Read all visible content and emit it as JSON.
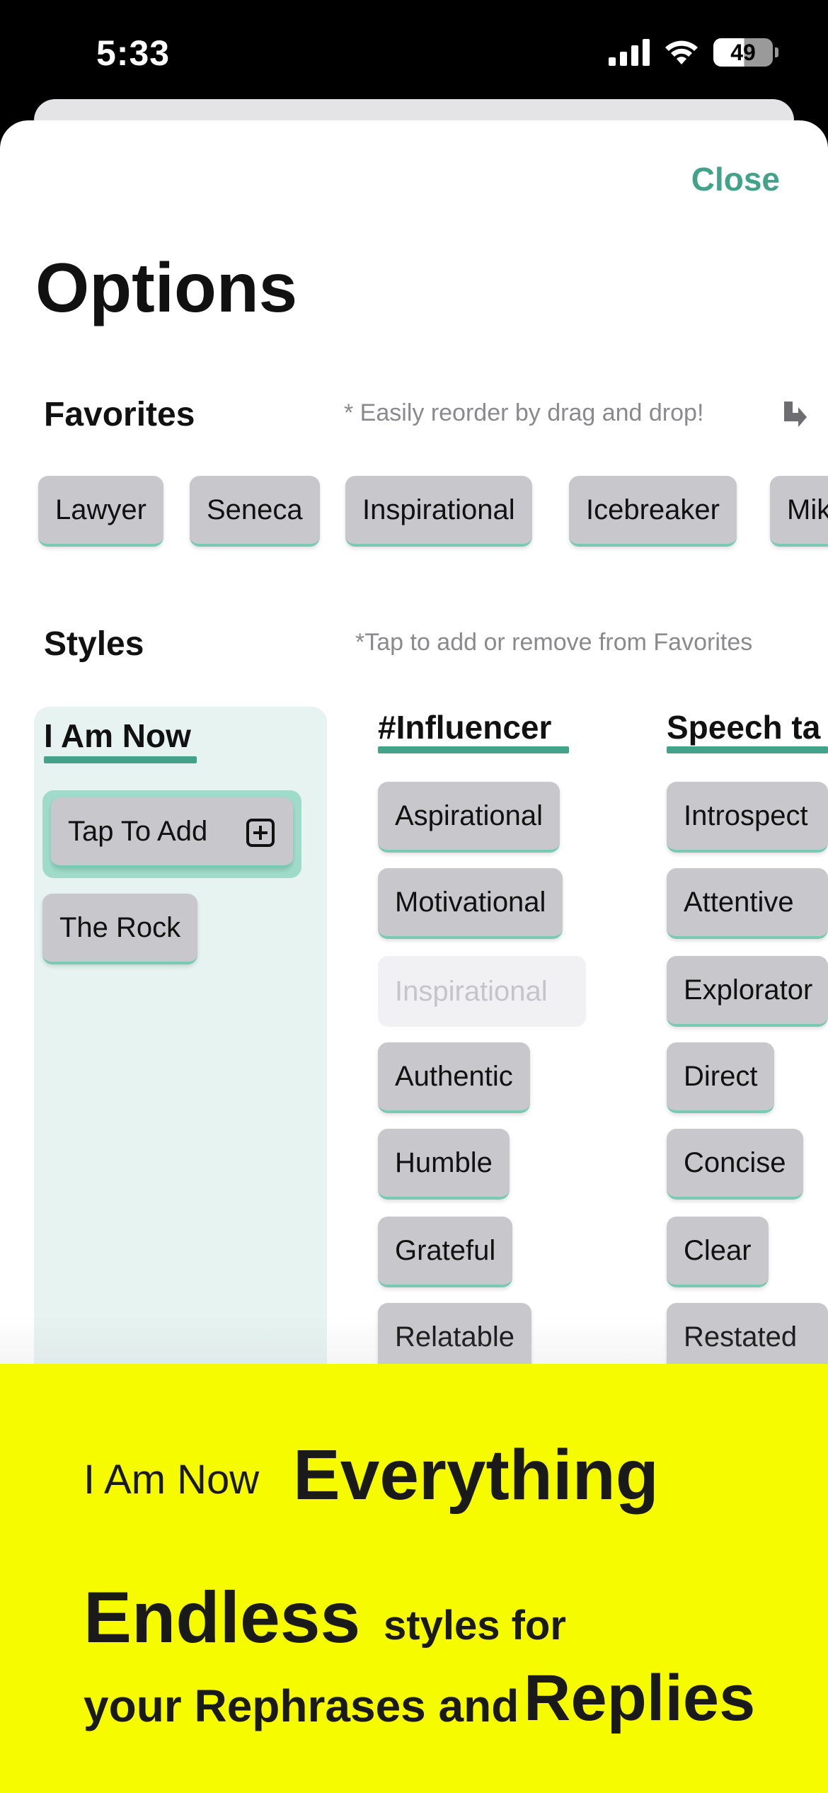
{
  "status_bar": {
    "time": "5:33",
    "battery": "49"
  },
  "header": {
    "close_label": "Close",
    "title": "Options"
  },
  "favorites": {
    "title": "Favorites",
    "hint": "* Easily reorder by drag and drop!",
    "items": [
      "Lawyer",
      "Seneca",
      "Inspirational",
      "Icebreaker",
      "Mik"
    ]
  },
  "styles": {
    "title": "Styles",
    "hint": "*Tap to add or remove from Favorites",
    "columns": [
      {
        "header": "I Am Now",
        "tap_to_add": "Tap To Add",
        "items": [
          "The Rock"
        ]
      },
      {
        "header": "#Influencer",
        "items": [
          "Aspirational",
          "Motivational",
          "Inspirational",
          "Authentic",
          "Humble",
          "Grateful",
          "Relatable"
        ],
        "disabled_item": "Inspirational"
      },
      {
        "header": "Speech ta",
        "items": [
          "Introspect",
          "Attentive",
          "Explorator",
          "Direct",
          "Concise",
          "Clear",
          "Restated"
        ]
      }
    ]
  },
  "promo": {
    "line1_small": "I Am Now",
    "line1_big": "Everything",
    "line2_big": "Endless",
    "line2_small": "styles for",
    "line3_small": "your Rephrases and",
    "line3_big": "Replies"
  }
}
